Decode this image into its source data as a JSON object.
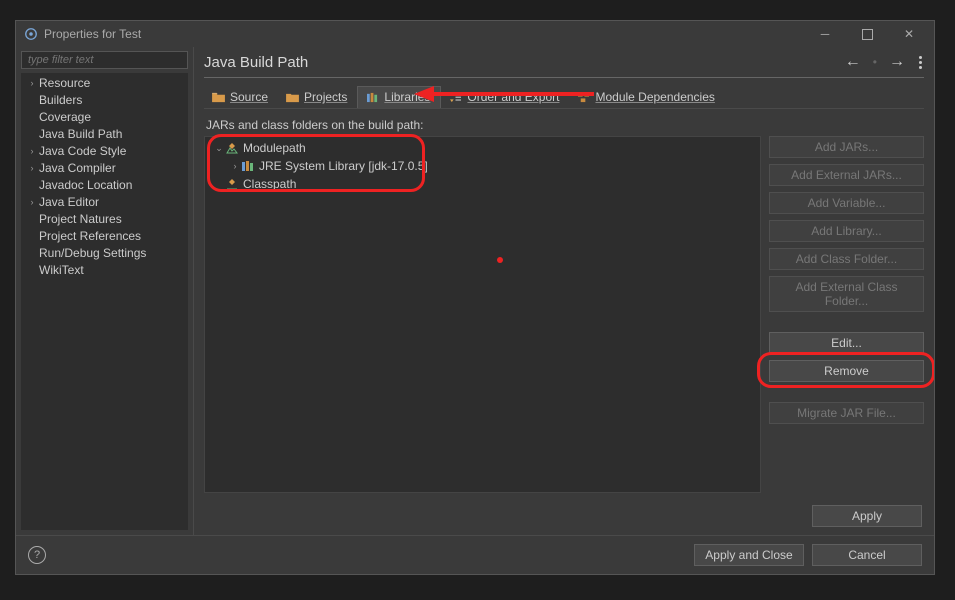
{
  "window": {
    "title": "Properties for Test"
  },
  "sidebar": {
    "filter_placeholder": "type filter text",
    "items": [
      {
        "label": "Resource",
        "expandable": true
      },
      {
        "label": "Builders",
        "expandable": false
      },
      {
        "label": "Coverage",
        "expandable": false
      },
      {
        "label": "Java Build Path",
        "expandable": false
      },
      {
        "label": "Java Code Style",
        "expandable": true
      },
      {
        "label": "Java Compiler",
        "expandable": true
      },
      {
        "label": "Javadoc Location",
        "expandable": false
      },
      {
        "label": "Java Editor",
        "expandable": true
      },
      {
        "label": "Project Natures",
        "expandable": false
      },
      {
        "label": "Project References",
        "expandable": false
      },
      {
        "label": "Run/Debug Settings",
        "expandable": false
      },
      {
        "label": "WikiText",
        "expandable": false
      }
    ]
  },
  "page": {
    "title": "Java Build Path",
    "tabs": {
      "source": "Source",
      "projects": "Projects",
      "libraries": "Libraries",
      "order_export": "Order and Export",
      "module_deps": "Module Dependencies"
    },
    "jars_label": "JARs and class folders on the build path:",
    "path_items": {
      "modulepath": "Modulepath",
      "jre": "JRE System Library [jdk-17.0.5]",
      "classpath": "Classpath"
    },
    "buttons": {
      "add_jars": "Add JARs...",
      "add_external_jars": "Add External JARs...",
      "add_variable": "Add Variable...",
      "add_library": "Add Library...",
      "add_class_folder": "Add Class Folder...",
      "add_external_class_folder": "Add External Class Folder...",
      "edit": "Edit...",
      "remove": "Remove",
      "migrate": "Migrate JAR File...",
      "apply": "Apply"
    }
  },
  "footer": {
    "apply_close": "Apply and Close",
    "cancel": "Cancel"
  }
}
